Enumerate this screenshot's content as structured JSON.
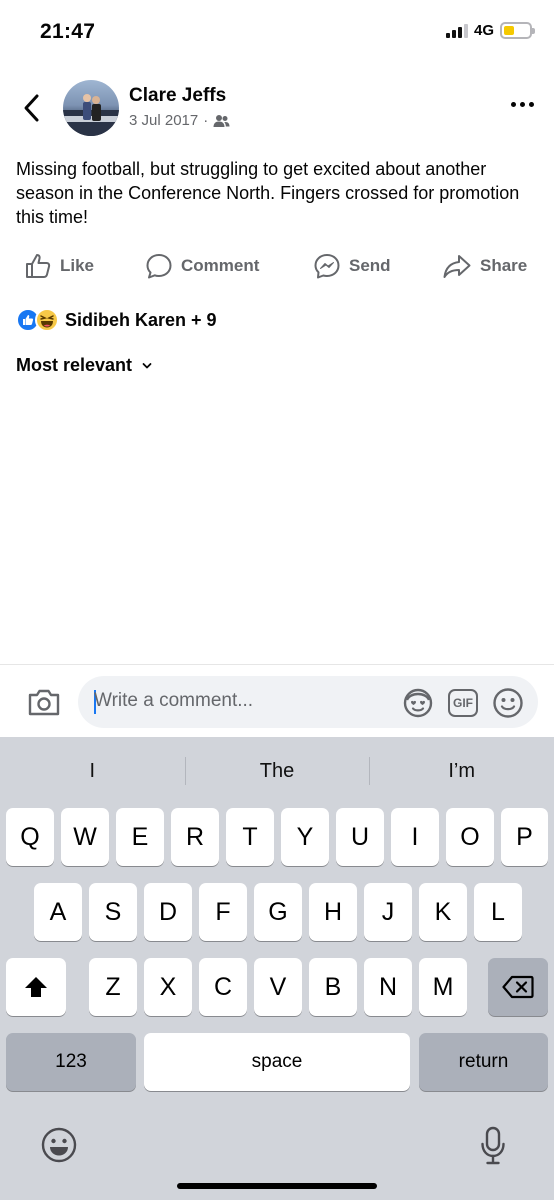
{
  "status_bar": {
    "time": "21:47",
    "network": "4G"
  },
  "header": {
    "author_name": "Clare Jeffs",
    "date": "3 Jul 2017",
    "separator": "·",
    "audience_icon": "friends-icon"
  },
  "post": {
    "text": "Missing football, but struggling to get excited about another season in the Conference North. Fingers crossed for promotion this time!"
  },
  "actions": {
    "like": "Like",
    "comment": "Comment",
    "send": "Send",
    "share": "Share"
  },
  "reactions": {
    "summary": "Sidibeh Karen + 9",
    "icons": [
      "like-reaction-icon",
      "haha-reaction-icon"
    ]
  },
  "comments": {
    "sort_label": "Most relevant"
  },
  "comment_composer": {
    "placeholder": "Write a comment...",
    "gif_label": "GIF"
  },
  "keyboard": {
    "predictions": [
      "I",
      "The",
      "I’m"
    ],
    "row1": [
      "Q",
      "W",
      "E",
      "R",
      "T",
      "Y",
      "U",
      "I",
      "O",
      "P"
    ],
    "row2": [
      "A",
      "S",
      "D",
      "F",
      "G",
      "H",
      "J",
      "K",
      "L"
    ],
    "row3": [
      "Z",
      "X",
      "C",
      "V",
      "B",
      "N",
      "M"
    ],
    "numbers_key": "123",
    "space_key": "space",
    "return_key": "return"
  },
  "colors": {
    "accent": "#1877f2",
    "secondary_text": "#65676b",
    "keyboard_bg": "#d1d4da"
  }
}
